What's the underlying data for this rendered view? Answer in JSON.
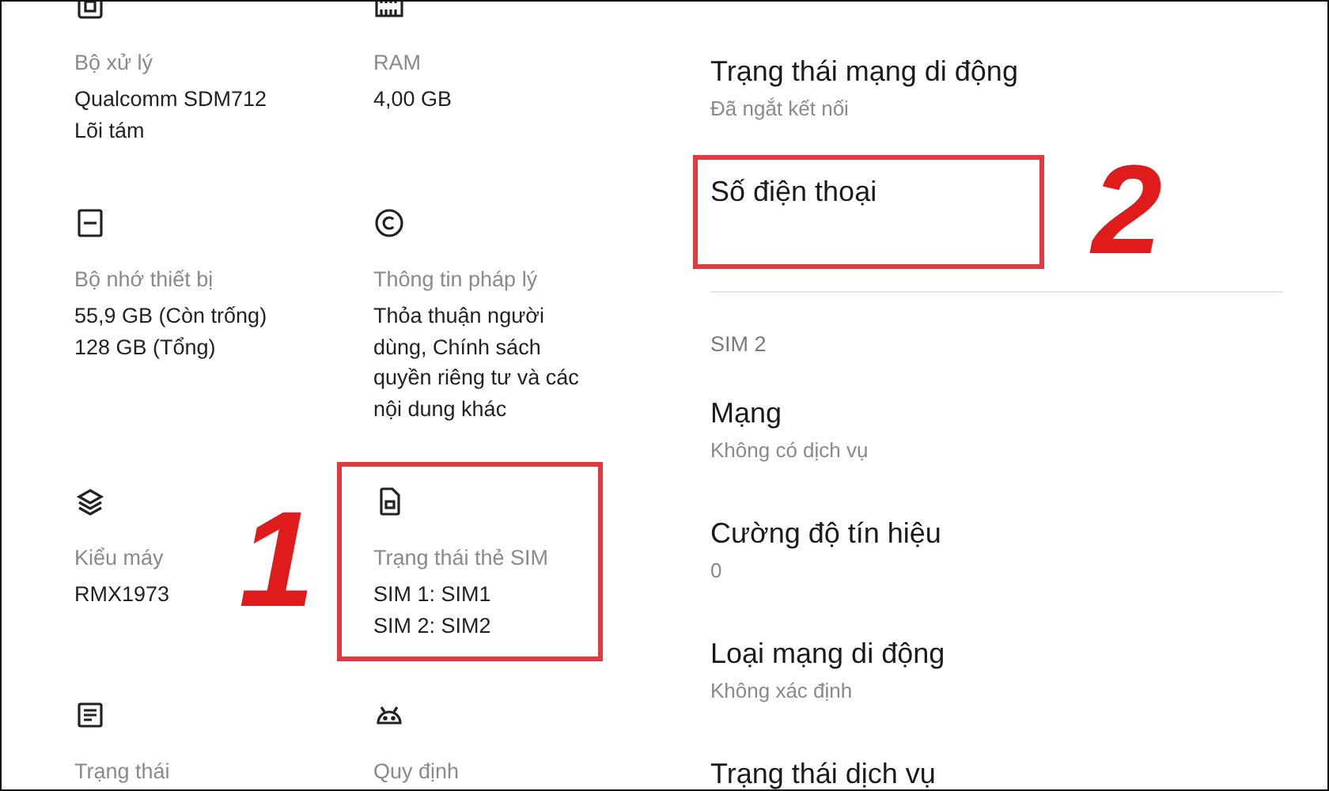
{
  "device_info": {
    "items": [
      {
        "label": "Bộ xử lý",
        "values": [
          "Qualcomm  SDM712",
          "Lõi tám"
        ],
        "highlighted": false
      },
      {
        "label": "RAM",
        "values": [
          "4,00 GB"
        ],
        "highlighted": false
      },
      {
        "label": "Bộ nhớ thiết bị",
        "values": [
          "55,9 GB (Còn trống)",
          "128 GB (Tổng)"
        ],
        "highlighted": false
      },
      {
        "label": "Thông tin pháp lý",
        "values": [
          "Thỏa thuận người",
          "dùng, Chính sách",
          "quyền riêng tư và các",
          "nội dung khác"
        ],
        "highlighted": false
      },
      {
        "label": "Kiểu máy",
        "values": [
          "RMX1973"
        ],
        "highlighted": false
      },
      {
        "label": "Trạng thái thẻ SIM",
        "values": [
          "SIM 1: SIM1",
          "SIM 2: SIM2"
        ],
        "highlighted": true
      },
      {
        "label": "Trạng thái",
        "highlighted": false
      },
      {
        "label": "Quy định",
        "highlighted": false
      }
    ],
    "callout": "1"
  },
  "sim_status": {
    "items": [
      {
        "kind": "row",
        "title": "Trạng thái mạng di động",
        "subtitle": "Đã ngắt kết nối",
        "highlighted": false
      },
      {
        "kind": "row",
        "title": "Số điện thoại",
        "highlighted": true
      },
      {
        "kind": "header",
        "title": "SIM 2"
      },
      {
        "kind": "row",
        "title": "Mạng",
        "subtitle": "Không có dịch vụ",
        "highlighted": false
      },
      {
        "kind": "row",
        "title": "Cường độ tín hiệu",
        "subtitle": "0",
        "highlighted": false
      },
      {
        "kind": "row",
        "title": "Loại mạng di động",
        "subtitle": "Không xác định",
        "highlighted": false
      },
      {
        "kind": "row",
        "title": "Trạng thái dịch vụ",
        "highlighted": false
      }
    ],
    "callout": "2"
  }
}
